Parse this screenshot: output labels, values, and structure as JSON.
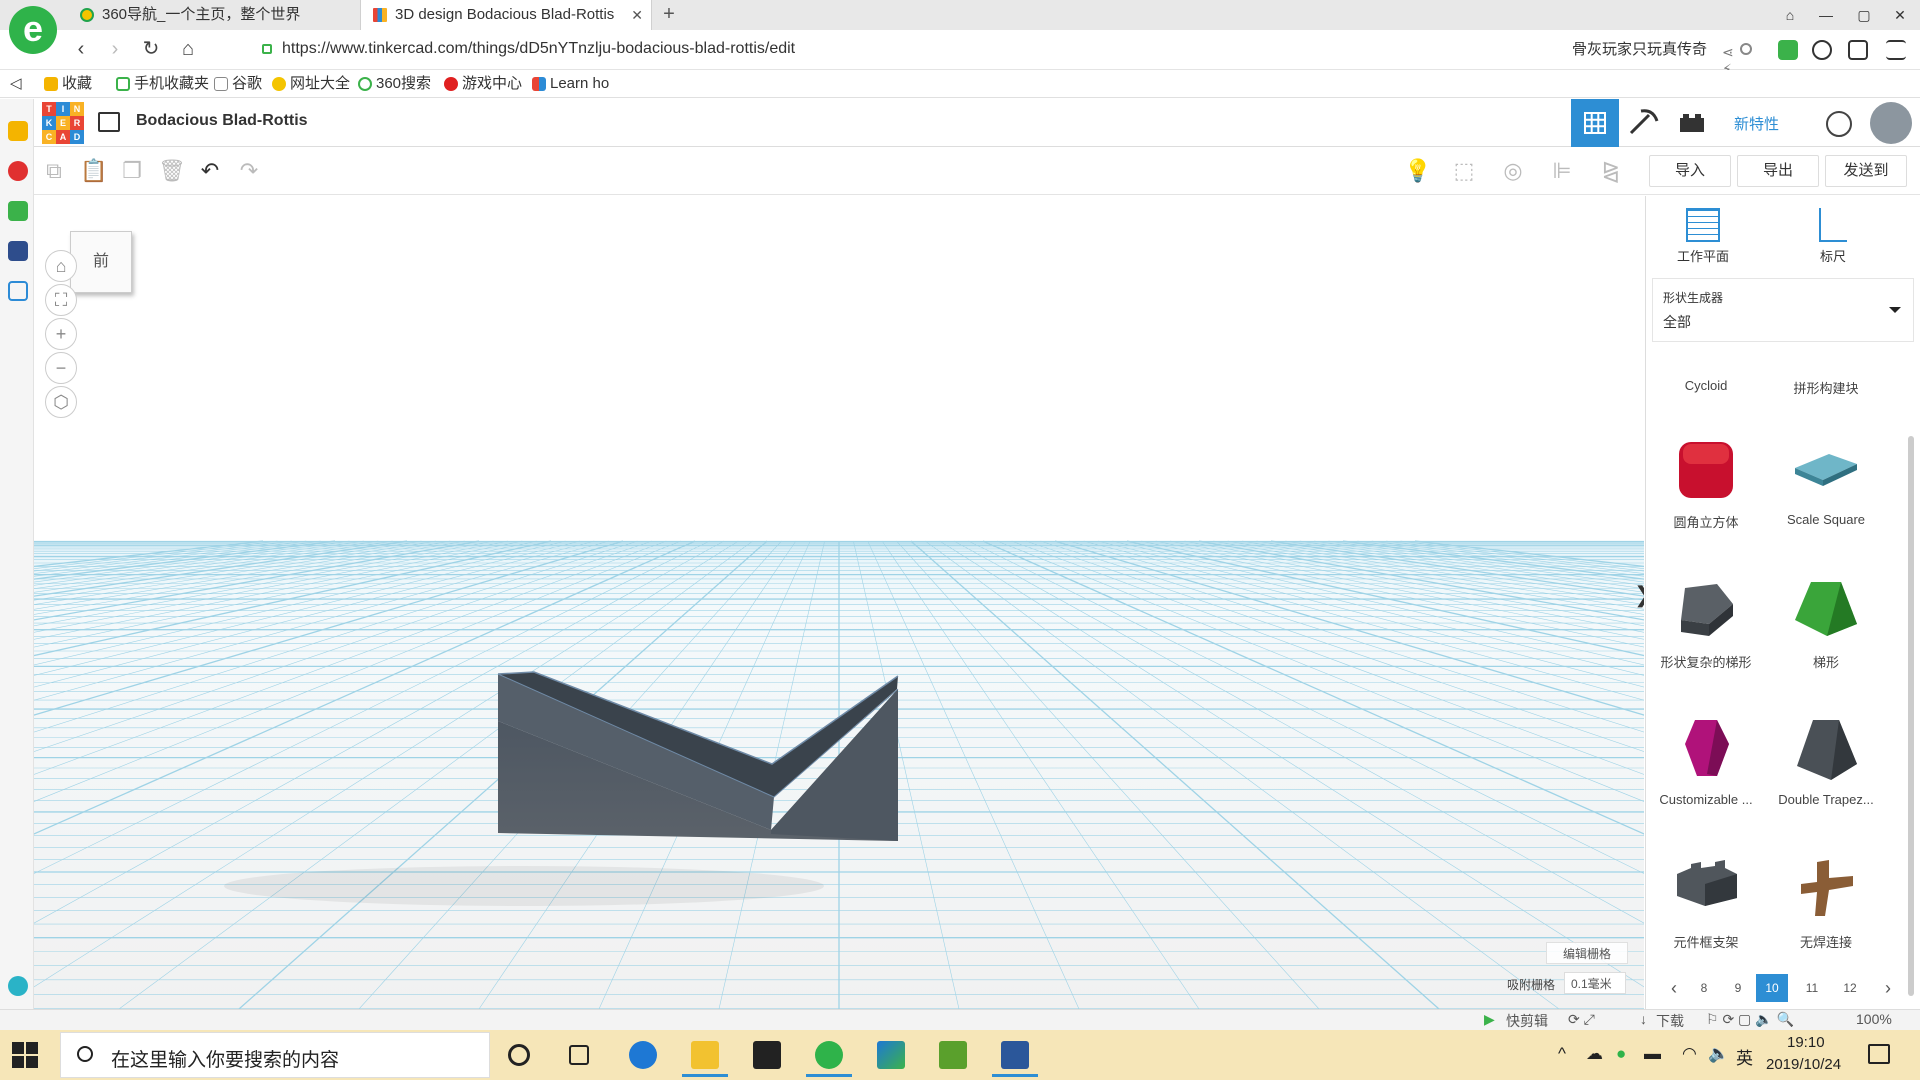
{
  "browser": {
    "tabs": [
      {
        "title": "360导航_一个主页，整个世界"
      },
      {
        "title": "3D design Bodacious Blad-Rottis"
      }
    ],
    "tab_close_glyph": "✕",
    "new_tab_glyph": "+",
    "window_controls": [
      "⌂",
      "—",
      "▢",
      "✕"
    ],
    "url": "https://www.tinkercad.com/things/dD5nYTnzlju-bodacious-blad-rottis/edit",
    "search_text": "骨灰玩家只玩真传奇",
    "bookmarks": [
      "收藏",
      "手机收藏夹",
      "谷歌",
      "网址大全",
      "360搜索",
      "游戏中心",
      "Learn ho"
    ]
  },
  "app": {
    "design_title": "Bodacious Blad-Rottis",
    "logo_letters": [
      "T",
      "I",
      "N",
      "K",
      "E",
      "R",
      "C",
      "A",
      "D"
    ],
    "new_features": "新特性",
    "actions": {
      "import": "导入",
      "export": "导出",
      "send_to": "发送到"
    }
  },
  "workplane": {
    "viewcube_label": "前",
    "edit_grid": "编辑栅格",
    "snap_grid_label": "吸附栅格",
    "snap_grid_value": "0.1毫米",
    "panel_toggle_glyph": "❯"
  },
  "panel": {
    "tools": [
      {
        "label": "工作平面"
      },
      {
        "label": "标尺"
      }
    ],
    "shape_generator_label": "形状生成器",
    "shape_generator_value": "全部",
    "column_headers": [
      "Cycloid",
      "拼形构建块"
    ],
    "shapes": [
      {
        "label": "圆角立方体",
        "color": "#c8102e",
        "icon": "rounded-cube-icon"
      },
      {
        "label": "Scale Square",
        "color": "#4a9bb0",
        "icon": "scale-square-icon"
      },
      {
        "label": "形状复杂的梯形",
        "color": "#44494e",
        "icon": "complex-trapezoid-icon"
      },
      {
        "label": "梯形",
        "color": "#2e8b2e",
        "icon": "trapezoid-icon"
      },
      {
        "label": "Customizable ...",
        "color": "#b0127a",
        "icon": "customizable-shape-icon"
      },
      {
        "label": "Double Trapez...",
        "color": "#44494e",
        "icon": "double-trapezoid-icon"
      },
      {
        "label": "元件框支架",
        "color": "#3f4449",
        "icon": "brick-frame-icon"
      },
      {
        "label": "无焊连接",
        "color": "#7a5230",
        "icon": "solderless-connector-icon"
      }
    ],
    "pages": [
      "8",
      "9",
      "10",
      "11",
      "12"
    ],
    "active_page": "10"
  },
  "statusbar": {
    "quick_clip": "快剪辑",
    "download": "下载",
    "zoom": "100%"
  },
  "taskbar": {
    "search_placeholder": "在这里输入你要搜索的内容",
    "ime": "英",
    "time": "19:10",
    "date": "2019/10/24"
  },
  "colors": {
    "accent": "#2d8ed4",
    "object": "#4a5460",
    "grid_line": "#9fd3e6"
  }
}
